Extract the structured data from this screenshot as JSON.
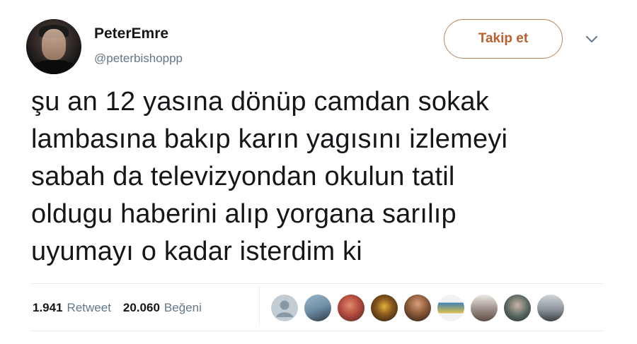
{
  "user": {
    "display_name": "PeterEmre",
    "handle": "@peterbishoppp"
  },
  "follow_button": {
    "label": "Takip et"
  },
  "tweet": {
    "lines": [
      "şu an 12 yasına dönüp camdan sokak",
      "lambasına bakıp karın yagısını izlemeyi",
      "sabah da televizyondan okulun tatil",
      "oldugu haberini alıp yorgana sarılıp",
      "uyumayı o kadar isterdim ki"
    ]
  },
  "stats": {
    "retweets_count": "1.941",
    "retweets_label": "Retweet",
    "likes_count": "20.060",
    "likes_label": "Beğeni"
  },
  "likers": [
    {
      "icon": "default-avatar",
      "color": "#c4ccd3"
    },
    {
      "icon": "avatar-photo",
      "color": "#6e8fa6"
    },
    {
      "icon": "avatar-photo",
      "color": "#b24a3e"
    },
    {
      "icon": "avatar-photo",
      "color": "#3b2a1c"
    },
    {
      "icon": "avatar-photo",
      "color": "#8a5a3a"
    },
    {
      "icon": "avatar-photo",
      "color": "#3f7fb8"
    },
    {
      "icon": "avatar-photo",
      "color": "#9c8f88"
    },
    {
      "icon": "avatar-photo",
      "color": "#5c6a63"
    },
    {
      "icon": "avatar-photo",
      "color": "#8d949b"
    }
  ],
  "colors": {
    "follow_border": "#b8845c",
    "follow_text": "#b8612e",
    "secondary_text": "#657786",
    "primary_text": "#14171a"
  }
}
